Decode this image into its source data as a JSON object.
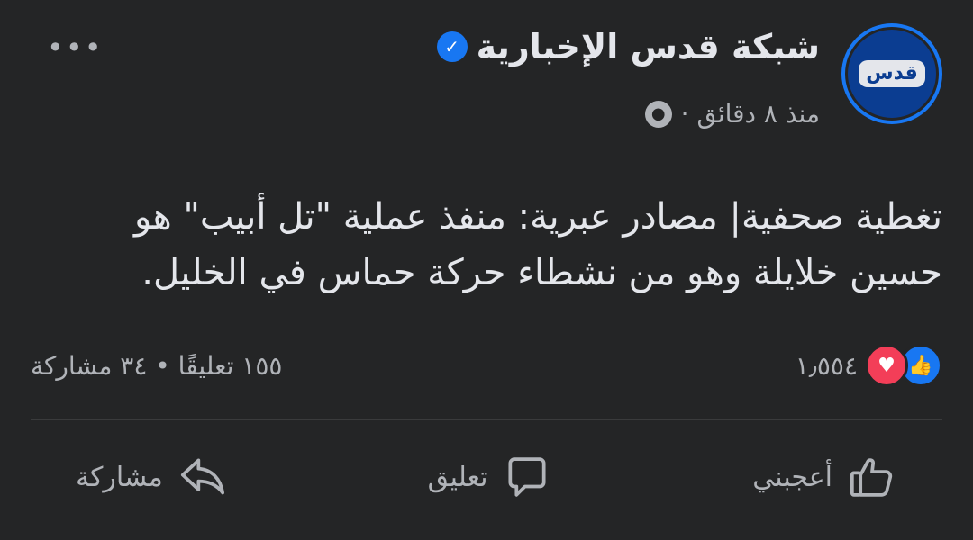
{
  "header": {
    "page_name": "شبكة قدس الإخبارية",
    "timestamp": "منذ ٨ دقائق ·",
    "avatar_text": "قدس"
  },
  "post": {
    "text": "تغطية صحفية| مصادر عبرية: منفذ عملية \"تل أبيب\" هو حسين خلايلة وهو من نشطاء حركة حماس في الخليل."
  },
  "stats": {
    "reactions_count": "١٫٥٥٤",
    "comments_shares": "١٥٥ تعليقًا • ٣٤ مشاركة"
  },
  "actions": {
    "like_label": "أعجبني",
    "comment_label": "تعليق",
    "share_label": "مشاركة"
  },
  "colors": {
    "background": "#242526",
    "accent": "#1877f2",
    "love": "#f33e58",
    "secondary_text": "#b0b3b8"
  },
  "icons": {
    "more": "more-dots-icon",
    "verified": "verified-badge-icon",
    "globe": "globe-icon",
    "like_reaction": "thumbs-up-reaction-icon",
    "love_reaction": "heart-reaction-icon",
    "like_action": "thumbs-up-icon",
    "comment_action": "comment-bubble-icon",
    "share_action": "share-arrow-icon"
  }
}
